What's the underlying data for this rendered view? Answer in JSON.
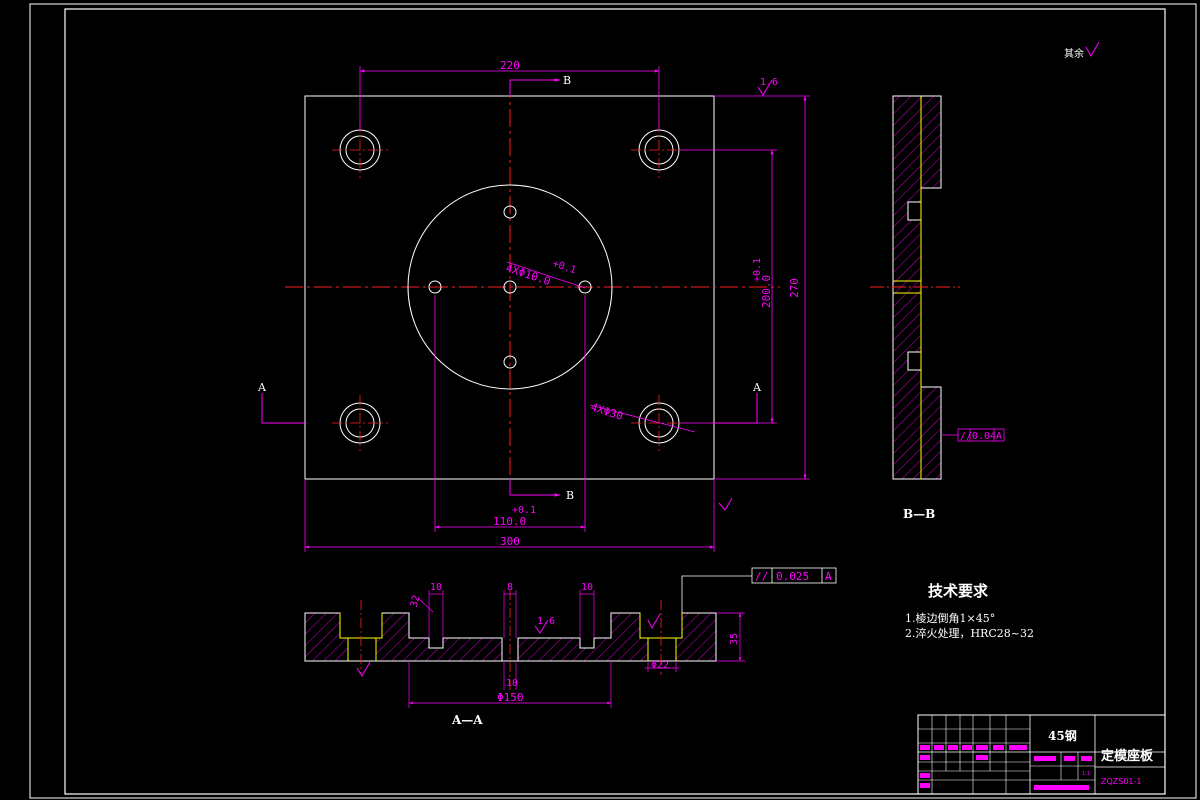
{
  "dimensions": {
    "top_220": "220",
    "left_300": "300",
    "height_270": "270",
    "height_200": "200.0",
    "tol_200": "+0.1",
    "width_110": "110.0",
    "tol_110": "+0.1",
    "holes_4x10": "4XΦ10.0",
    "tol_4x10": "+0.1",
    "holes_4x30": "4XΦ30",
    "sec_10_left": "10",
    "sec_8": "8",
    "sec_10_right": "10",
    "sec_32": "32",
    "sec_35": "35",
    "sec_phi22": "Φ22",
    "sec_10_bottom": "10",
    "sec_phi150": "Φ150",
    "rough_16_a": "1.6",
    "rough_16_b": "1.6"
  },
  "section_labels": {
    "a_left": "A",
    "a_right": "A",
    "b_top": "B",
    "b_bottom": "B",
    "aa_title": "A—A",
    "bb_title": "B—B"
  },
  "tolerance_frames": {
    "main": {
      "symbol": "//",
      "value": "0.025",
      "datum": "A"
    },
    "side": {
      "symbol": "//",
      "value": "0.04",
      "datum": "A"
    }
  },
  "roughness_note": {
    "label": "其余"
  },
  "tech_requirements": {
    "title": "技术要求",
    "items": [
      "1.棱边倒角1×45°",
      "2.淬火处理，HRC28~32"
    ]
  },
  "title_block": {
    "material": "45钢",
    "part_name": "定模座板",
    "drawing_no": "ZQZS01-1",
    "scale": "1:1"
  },
  "colors": {
    "outline": "#ffffff",
    "dimension": "#ff00ff",
    "centerline": "#ff2020",
    "hatch": "#ff00ff",
    "hidden": "#ffff00"
  }
}
